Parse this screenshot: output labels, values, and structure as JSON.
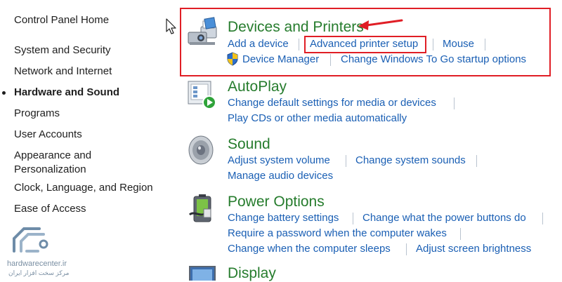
{
  "sidebar": {
    "items": [
      {
        "label": "Control Panel Home"
      },
      {
        "label": "System and Security"
      },
      {
        "label": "Network and Internet"
      },
      {
        "label": "Hardware and Sound"
      },
      {
        "label": "Programs"
      },
      {
        "label": "User Accounts"
      },
      {
        "label": "Appearance and"
      },
      {
        "label": "Personalization"
      },
      {
        "label": "Clock, Language, and Region"
      },
      {
        "label": "Ease of Access"
      }
    ]
  },
  "categories": {
    "devices": {
      "title": "Devices and Printers",
      "links": [
        "Add a device",
        "Advanced printer setup",
        "Mouse",
        "Device Manager",
        "Change Windows To Go startup options"
      ]
    },
    "autoplay": {
      "title": "AutoPlay",
      "links": [
        "Change default settings for media or devices",
        "Play CDs or other media automatically"
      ]
    },
    "sound": {
      "title": "Sound",
      "links": [
        "Adjust system volume",
        "Change system sounds",
        "Manage audio devices"
      ]
    },
    "power": {
      "title": "Power Options",
      "links": [
        "Change battery settings",
        "Change what the power buttons do",
        "Require a password when the computer wakes",
        "Change when the computer sleeps",
        "Adjust screen brightness"
      ]
    },
    "display": {
      "title": "Display"
    }
  },
  "watermark": {
    "site": "hardwarecenter.ir",
    "tagline": "مرکز سخت افزار ایران"
  },
  "colors": {
    "title_green": "#267c2d",
    "link_blue": "#1a5fb4",
    "annotation_red": "#e01e25"
  }
}
